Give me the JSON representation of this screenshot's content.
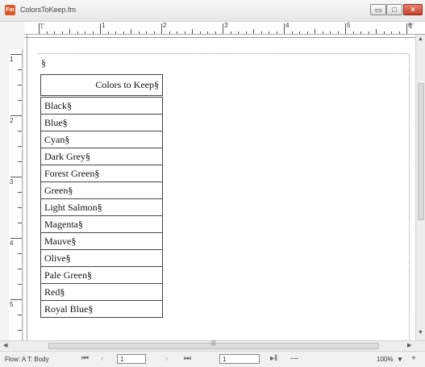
{
  "window": {
    "title": "ColorsToKeep.fm",
    "app_icon": "framemaker-app-icon"
  },
  "title_controls": {
    "minimize": "▭",
    "maximize": "□",
    "close": "✕"
  },
  "ruler": {
    "h_numbers": [
      "1",
      "2",
      "3",
      "4",
      "5",
      "6"
    ],
    "v_numbers": [
      "1",
      "2",
      "3",
      "4",
      "5"
    ]
  },
  "document": {
    "para_mark": "§",
    "table": {
      "header": "Colors to Keep§",
      "rows": [
        "Black§",
        "Blue§",
        "Cyan§",
        "Dark Grey§",
        "Forest Green§",
        "Green§",
        "Light Salmon§",
        "Magenta§",
        "Mauve§",
        "Olive§",
        "Pale Green§",
        "Red§",
        "Royal Blue§"
      ]
    }
  },
  "status": {
    "flow": "Flow: A  T: Body",
    "page_field": "1",
    "page_field2": "1",
    "zoom": "100%",
    "zoom_arrow": "▼",
    "zoom_out": "—",
    "zoom_in": "+"
  },
  "colors": {
    "app_icon": "#d8582a",
    "close_button": "#c6412d"
  }
}
